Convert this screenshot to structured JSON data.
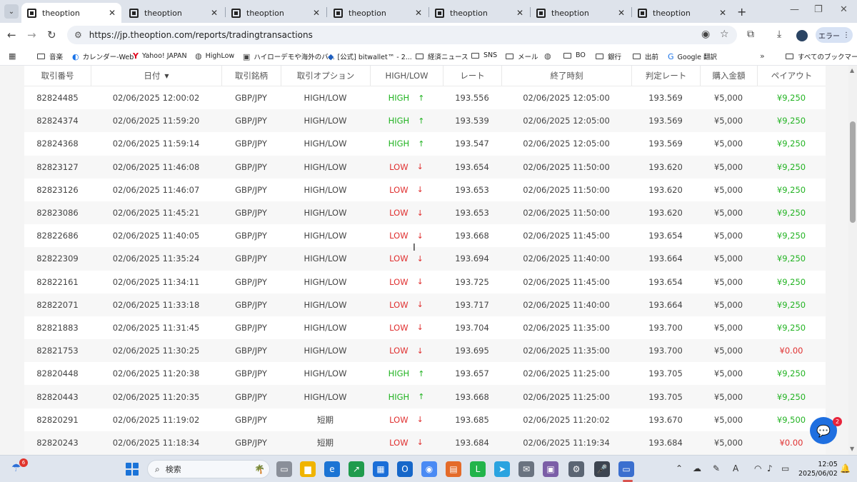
{
  "browser": {
    "tabs": [
      {
        "title": "theoption",
        "active": true
      },
      {
        "title": "theoption",
        "active": false
      },
      {
        "title": "theoption",
        "active": false
      },
      {
        "title": "theoption",
        "active": false
      },
      {
        "title": "theoption",
        "active": false
      },
      {
        "title": "theoption",
        "active": false
      },
      {
        "title": "theoption",
        "active": false
      }
    ],
    "new_tab": "+",
    "url": "https://jp.theoption.com/reports/tradingtransactions",
    "error_pill": "エラー",
    "bookmarks": [
      "音楽",
      "カレンダー-Web",
      "Yahoo! JAPAN",
      "HighLow",
      "ハイローデモや海外のバ...",
      "[公式] bitwallet™ - 2...",
      "経済ニュース",
      "SNS",
      "メール",
      "BO",
      "銀行",
      "出前",
      "Google 翻訳"
    ],
    "all_bookmarks": "すべてのブックマーク"
  },
  "table": {
    "headers": [
      "取引番号",
      "日付",
      "取引銘柄",
      "取引オプション",
      "HIGH/LOW",
      "レート",
      "終了時刻",
      "判定レート",
      "購入金額",
      "ペイアウト"
    ],
    "rows": [
      {
        "id": "82824485",
        "date": "02/06/2025 12:00:02",
        "asset": "GBP/JPY",
        "option": "HIGH/LOW",
        "dir": "HIGH",
        "rate": "193.556",
        "expiry": "02/06/2025 12:05:00",
        "judge": "193.569",
        "amount": "¥5,000",
        "payout": "¥9,250"
      },
      {
        "id": "82824374",
        "date": "02/06/2025 11:59:20",
        "asset": "GBP/JPY",
        "option": "HIGH/LOW",
        "dir": "HIGH",
        "rate": "193.539",
        "expiry": "02/06/2025 12:05:00",
        "judge": "193.569",
        "amount": "¥5,000",
        "payout": "¥9,250"
      },
      {
        "id": "82824368",
        "date": "02/06/2025 11:59:14",
        "asset": "GBP/JPY",
        "option": "HIGH/LOW",
        "dir": "HIGH",
        "rate": "193.547",
        "expiry": "02/06/2025 12:05:00",
        "judge": "193.569",
        "amount": "¥5,000",
        "payout": "¥9,250"
      },
      {
        "id": "82823127",
        "date": "02/06/2025 11:46:08",
        "asset": "GBP/JPY",
        "option": "HIGH/LOW",
        "dir": "LOW",
        "rate": "193.654",
        "expiry": "02/06/2025 11:50:00",
        "judge": "193.620",
        "amount": "¥5,000",
        "payout": "¥9,250"
      },
      {
        "id": "82823126",
        "date": "02/06/2025 11:46:07",
        "asset": "GBP/JPY",
        "option": "HIGH/LOW",
        "dir": "LOW",
        "rate": "193.653",
        "expiry": "02/06/2025 11:50:00",
        "judge": "193.620",
        "amount": "¥5,000",
        "payout": "¥9,250"
      },
      {
        "id": "82823086",
        "date": "02/06/2025 11:45:21",
        "asset": "GBP/JPY",
        "option": "HIGH/LOW",
        "dir": "LOW",
        "rate": "193.653",
        "expiry": "02/06/2025 11:50:00",
        "judge": "193.620",
        "amount": "¥5,000",
        "payout": "¥9,250"
      },
      {
        "id": "82822686",
        "date": "02/06/2025 11:40:05",
        "asset": "GBP/JPY",
        "option": "HIGH/LOW",
        "dir": "LOW",
        "rate": "193.668",
        "expiry": "02/06/2025 11:45:00",
        "judge": "193.654",
        "amount": "¥5,000",
        "payout": "¥9,250"
      },
      {
        "id": "82822309",
        "date": "02/06/2025 11:35:24",
        "asset": "GBP/JPY",
        "option": "HIGH/LOW",
        "dir": "LOW",
        "rate": "193.694",
        "expiry": "02/06/2025 11:40:00",
        "judge": "193.664",
        "amount": "¥5,000",
        "payout": "¥9,250"
      },
      {
        "id": "82822161",
        "date": "02/06/2025 11:34:11",
        "asset": "GBP/JPY",
        "option": "HIGH/LOW",
        "dir": "LOW",
        "rate": "193.725",
        "expiry": "02/06/2025 11:45:00",
        "judge": "193.654",
        "amount": "¥5,000",
        "payout": "¥9,250"
      },
      {
        "id": "82822071",
        "date": "02/06/2025 11:33:18",
        "asset": "GBP/JPY",
        "option": "HIGH/LOW",
        "dir": "LOW",
        "rate": "193.717",
        "expiry": "02/06/2025 11:40:00",
        "judge": "193.664",
        "amount": "¥5,000",
        "payout": "¥9,250"
      },
      {
        "id": "82821883",
        "date": "02/06/2025 11:31:45",
        "asset": "GBP/JPY",
        "option": "HIGH/LOW",
        "dir": "LOW",
        "rate": "193.704",
        "expiry": "02/06/2025 11:35:00",
        "judge": "193.700",
        "amount": "¥5,000",
        "payout": "¥9,250"
      },
      {
        "id": "82821753",
        "date": "02/06/2025 11:30:25",
        "asset": "GBP/JPY",
        "option": "HIGH/LOW",
        "dir": "LOW",
        "rate": "193.695",
        "expiry": "02/06/2025 11:35:00",
        "judge": "193.700",
        "amount": "¥5,000",
        "payout": "¥0.00"
      },
      {
        "id": "82820448",
        "date": "02/06/2025 11:20:38",
        "asset": "GBP/JPY",
        "option": "HIGH/LOW",
        "dir": "HIGH",
        "rate": "193.657",
        "expiry": "02/06/2025 11:25:00",
        "judge": "193.705",
        "amount": "¥5,000",
        "payout": "¥9,250"
      },
      {
        "id": "82820443",
        "date": "02/06/2025 11:20:35",
        "asset": "GBP/JPY",
        "option": "HIGH/LOW",
        "dir": "HIGH",
        "rate": "193.668",
        "expiry": "02/06/2025 11:25:00",
        "judge": "193.705",
        "amount": "¥5,000",
        "payout": "¥9,250"
      },
      {
        "id": "82820291",
        "date": "02/06/2025 11:19:02",
        "asset": "GBP/JPY",
        "option": "短期",
        "dir": "LOW",
        "rate": "193.685",
        "expiry": "02/06/2025 11:20:02",
        "judge": "193.670",
        "amount": "¥5,000",
        "payout": "¥9,500"
      },
      {
        "id": "82820243",
        "date": "02/06/2025 11:18:34",
        "asset": "GBP/JPY",
        "option": "短期",
        "dir": "LOW",
        "rate": "193.684",
        "expiry": "02/06/2025 11:19:34",
        "judge": "193.684",
        "amount": "¥5,000",
        "payout": "¥0.00"
      }
    ]
  },
  "chat": {
    "badge": "2"
  },
  "taskbar": {
    "weather_badge": "6",
    "search_label": "検索",
    "time": "12:05",
    "date": "2025/06/02"
  },
  "colors": {
    "high": "#22b322",
    "low": "#e03030",
    "payout_win": "#22b322",
    "payout_loss": "#e03030"
  }
}
